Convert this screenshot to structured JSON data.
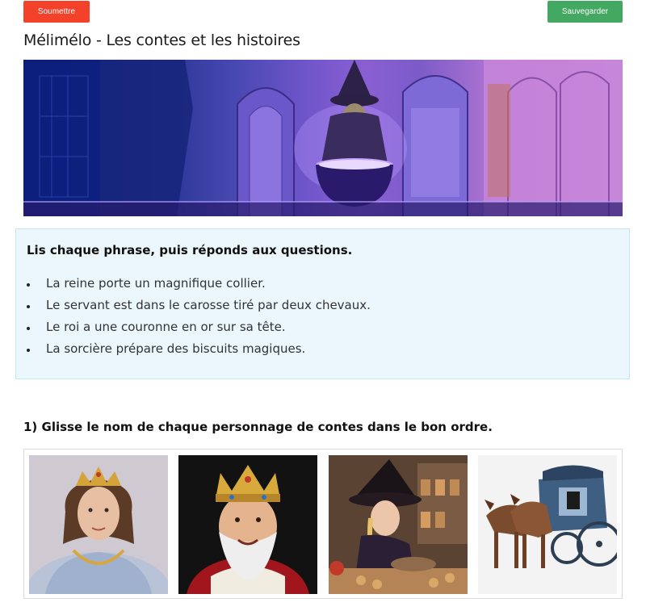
{
  "toolbar": {
    "submit_label": "Soumettre",
    "save_label": "Sauvegarder",
    "submit_color": "#f4412a",
    "save_color": "#43a862"
  },
  "page": {
    "title": "Mélimélo - Les contes et les histoires"
  },
  "banner": {
    "image": "witch-cauldron-banner"
  },
  "instructions": {
    "title": "Lis chaque phrase, puis réponds aux questions.",
    "sentences": [
      "La reine porte un magnifique collier.",
      "Le servant est dans le carosse tiré par deux chevaux.",
      "Le roi a une couronne en or sur sa tête.",
      "La sorcière prépare des biscuits magiques."
    ]
  },
  "question1": {
    "text": "1) Glisse le nom de chaque personnage de contes dans le bon ordre.",
    "cards": [
      {
        "image": "queen-image"
      },
      {
        "image": "king-image"
      },
      {
        "image": "witch-image"
      },
      {
        "image": "carriage-image"
      }
    ]
  }
}
